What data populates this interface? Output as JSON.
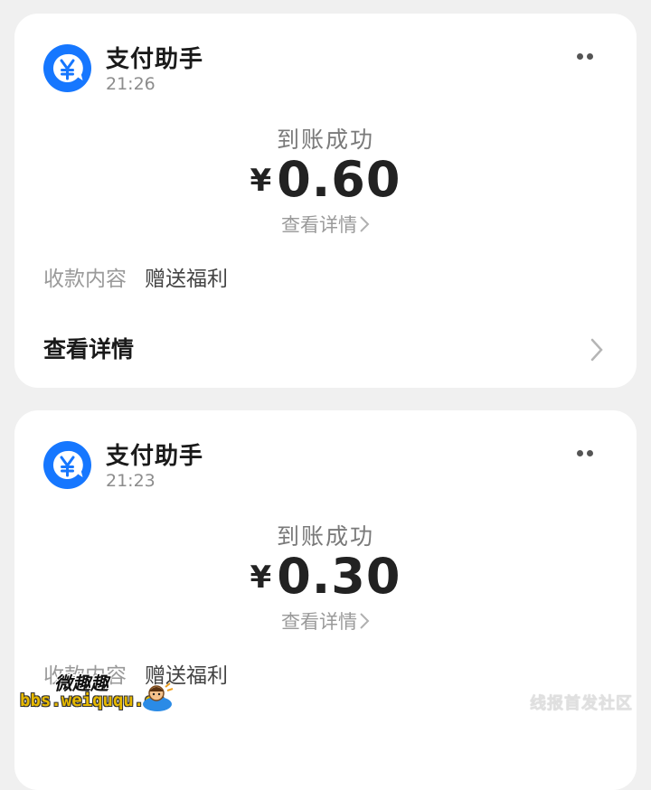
{
  "notifications": [
    {
      "app_name": "支付助手",
      "time": "21:26",
      "status": "到账成功",
      "currency_symbol": "¥",
      "amount": "0.60",
      "detail_link": "查看详情",
      "field_label": "收款内容",
      "field_value": "赠送福利",
      "footer_label": "查看详情"
    },
    {
      "app_name": "支付助手",
      "time": "21:23",
      "status": "到账成功",
      "currency_symbol": "¥",
      "amount": "0.30",
      "detail_link": "查看详情",
      "field_label": "收款内容",
      "field_value": "赠送福利"
    }
  ],
  "watermarks": {
    "site_name": "微趣趣",
    "site_url": "bbs.weiququ.cn",
    "corner_text": "线报首发社区"
  },
  "colors": {
    "brand_blue": "#1677ff",
    "background": "#f0f0f0",
    "card": "#ffffff"
  },
  "icons": {
    "avatar": "yen-chat-bubble-icon",
    "menu": "more-dots-icon",
    "chevron": "chevron-right-icon"
  }
}
